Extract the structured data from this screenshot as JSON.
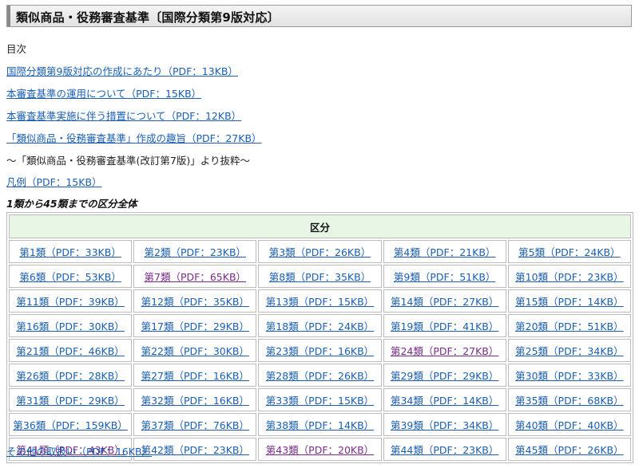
{
  "page_title": "類似商品・役務審査基準〔国際分類第9版対応〕",
  "toc_label": "目次",
  "links": [
    "国際分類第9版対応の作成にあたり（PDF：13KB）",
    "本審査基準の運用について（PDF：15KB）",
    "本審査基準実施に伴う措置について（PDF：12KB）",
    "「類似商品・役務審査基準」作成の趣旨（PDF：27KB）"
  ],
  "excerpt_note": "〜「類似商品・役務審査基準(改訂第7版)」より抜粋〜",
  "hanrei_link": "凡例（PDF：15KB）",
  "section_heading": "1類から45類までの区分全体",
  "table": {
    "header": "区分",
    "cells": [
      "第1類（PDF：33KB）",
      "第2類（PDF：23KB）",
      "第3類（PDF：26KB）",
      "第4類（PDF：21KB）",
      "第5類（PDF：24KB）",
      "第6類（PDF：53KB）",
      "第7類（PDF：65KB）",
      "第8類（PDF：35KB）",
      "第9類（PDF：51KB）",
      "第10類（PDF：23KB）",
      "第11類（PDF：39KB）",
      "第12類（PDF：35KB）",
      "第13類（PDF：15KB）",
      "第14類（PDF：27KB）",
      "第15類（PDF：14KB）",
      "第16類（PDF：30KB）",
      "第17類（PDF：29KB）",
      "第18類（PDF：24KB）",
      "第19類（PDF：41KB）",
      "第20類（PDF：51KB）",
      "第21類（PDF：46KB）",
      "第22類（PDF：30KB）",
      "第23類（PDF：16KB）",
      "第24類（PDF：27KB）",
      "第25類（PDF：34KB）",
      "第26類（PDF：28KB）",
      "第27類（PDF：16KB）",
      "第28類（PDF：26KB）",
      "第29類（PDF：29KB）",
      "第30類（PDF：33KB）",
      "第31類（PDF：29KB）",
      "第32類（PDF：16KB）",
      "第33類（PDF：15KB）",
      "第34類（PDF：14KB）",
      "第35類（PDF：68KB）",
      "第36類（PDF：159KB）",
      "第37類（PDF：76KB）",
      "第38類（PDF：14KB）",
      "第39類（PDF：34KB）",
      "第40類（PDF：40KB）",
      "第41類（PDF：43KB）",
      "第42類（PDF：23KB）",
      "第43類（PDF：20KB）",
      "第44類（PDF：23KB）",
      "第45類（PDF：26KB）"
    ],
    "visited": [
      "第7類（PDF：65KB）",
      "第24類（PDF：27KB）",
      "第41類（PDF：43KB）",
      "第43類（PDF：20KB）"
    ]
  },
  "other_link": "その他の取扱い（PDF：16KB）",
  "colors": {
    "link": "#1a5fb4",
    "visited": "#7a2a8c",
    "header_bg": "#e8f6e6"
  }
}
